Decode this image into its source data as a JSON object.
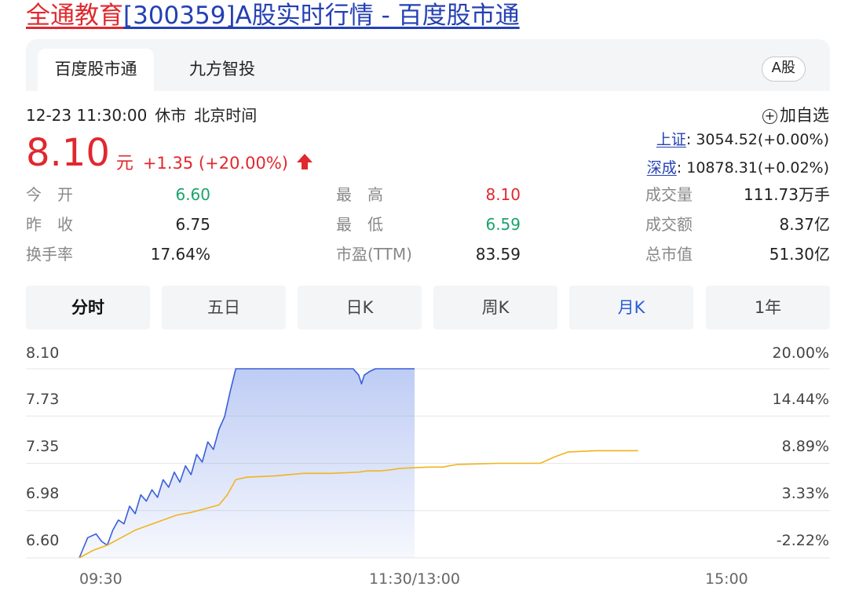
{
  "title": {
    "stock_name": "全通教育",
    "rest": "[300359]A股实时行情 - 百度股市通"
  },
  "tabs": [
    {
      "label": "百度股市通",
      "active": true
    },
    {
      "label": "九方智投",
      "active": false
    }
  ],
  "market_badge": "A股",
  "quote": {
    "datetime": "12-23 11:30:00",
    "status": "休市",
    "timezone": "北京时间",
    "price": "8.10",
    "unit": "元",
    "change": "+1.35 (+20.00%)",
    "direction": "up",
    "up_color": "#e0282e"
  },
  "add_watch": "加自选",
  "indices": [
    {
      "name": "上证",
      "value": ": 3054.52(+0.00%)"
    },
    {
      "name": "深成",
      "value": ": 10878.31(+0.02%)"
    }
  ],
  "stats": [
    {
      "label": "今　开",
      "value": "6.60",
      "color": "green"
    },
    {
      "label": "最　高",
      "value": "8.10",
      "color": "red"
    },
    {
      "label": "成交量",
      "value": "111.73万手",
      "color": "dark"
    },
    {
      "label": "昨　收",
      "value": "6.75",
      "color": "dark"
    },
    {
      "label": "最　低",
      "value": "6.59",
      "color": "green"
    },
    {
      "label": "成交额",
      "value": "8.37亿",
      "color": "dark"
    },
    {
      "label": "换手率",
      "value": "17.64%",
      "color": "dark"
    },
    {
      "label": "市盈(TTM)",
      "value": "83.59",
      "color": "dark"
    },
    {
      "label": "总市值",
      "value": "51.30亿",
      "color": "dark"
    }
  ],
  "chart_tabs": [
    {
      "label": "分时",
      "state": "active"
    },
    {
      "label": "五日",
      "state": ""
    },
    {
      "label": "日K",
      "state": ""
    },
    {
      "label": "周K",
      "state": ""
    },
    {
      "label": "月K",
      "state": "blue"
    },
    {
      "label": "1年",
      "state": ""
    }
  ],
  "chart_data": {
    "type": "area",
    "y_left_ticks": [
      "8.10",
      "7.73",
      "7.35",
      "6.98",
      "6.60"
    ],
    "y_right_ticks": [
      "20.00%",
      "14.44%",
      "8.89%",
      "3.33%",
      "-2.22%"
    ],
    "x_ticks": [
      "09:30",
      "11:30/13:00",
      "15:00"
    ],
    "ylim": [
      6.6,
      8.1
    ],
    "session_minutes": 240,
    "series": [
      {
        "color": "#3a5fd9",
        "fill": true,
        "points": [
          [
            0,
            6.6
          ],
          [
            3,
            6.76
          ],
          [
            6,
            6.79
          ],
          [
            8,
            6.73
          ],
          [
            10,
            6.7
          ],
          [
            12,
            6.82
          ],
          [
            14,
            6.9
          ],
          [
            16,
            6.87
          ],
          [
            18,
            7.01
          ],
          [
            20,
            6.95
          ],
          [
            22,
            7.1
          ],
          [
            24,
            7.05
          ],
          [
            26,
            7.14
          ],
          [
            28,
            7.08
          ],
          [
            30,
            7.22
          ],
          [
            32,
            7.16
          ],
          [
            34,
            7.28
          ],
          [
            36,
            7.2
          ],
          [
            38,
            7.33
          ],
          [
            40,
            7.26
          ],
          [
            42,
            7.42
          ],
          [
            44,
            7.36
          ],
          [
            46,
            7.52
          ],
          [
            48,
            7.46
          ],
          [
            50,
            7.62
          ],
          [
            52,
            7.72
          ],
          [
            54,
            7.92
          ],
          [
            56,
            8.1
          ],
          [
            98,
            8.1
          ],
          [
            100,
            8.05
          ],
          [
            101,
            7.98
          ],
          [
            102,
            8.05
          ],
          [
            104,
            8.08
          ],
          [
            106,
            8.1
          ],
          [
            120,
            8.1
          ]
        ]
      },
      {
        "color": "#f0b41e",
        "fill": false,
        "points": [
          [
            0,
            6.6
          ],
          [
            5,
            6.66
          ],
          [
            10,
            6.7
          ],
          [
            15,
            6.76
          ],
          [
            20,
            6.82
          ],
          [
            25,
            6.86
          ],
          [
            30,
            6.9
          ],
          [
            35,
            6.94
          ],
          [
            40,
            6.96
          ],
          [
            45,
            6.99
          ],
          [
            50,
            7.02
          ],
          [
            53,
            7.1
          ],
          [
            56,
            7.22
          ],
          [
            60,
            7.24
          ],
          [
            70,
            7.25
          ],
          [
            80,
            7.27
          ],
          [
            90,
            7.27
          ],
          [
            100,
            7.28
          ],
          [
            103,
            7.29
          ],
          [
            108,
            7.29
          ],
          [
            112,
            7.3
          ],
          [
            115,
            7.31
          ],
          [
            125,
            7.32
          ],
          [
            130,
            7.32
          ],
          [
            135,
            7.34
          ],
          [
            150,
            7.35
          ],
          [
            165,
            7.35
          ],
          [
            170,
            7.4
          ],
          [
            175,
            7.44
          ],
          [
            185,
            7.45
          ],
          [
            200,
            7.45
          ]
        ]
      }
    ]
  }
}
